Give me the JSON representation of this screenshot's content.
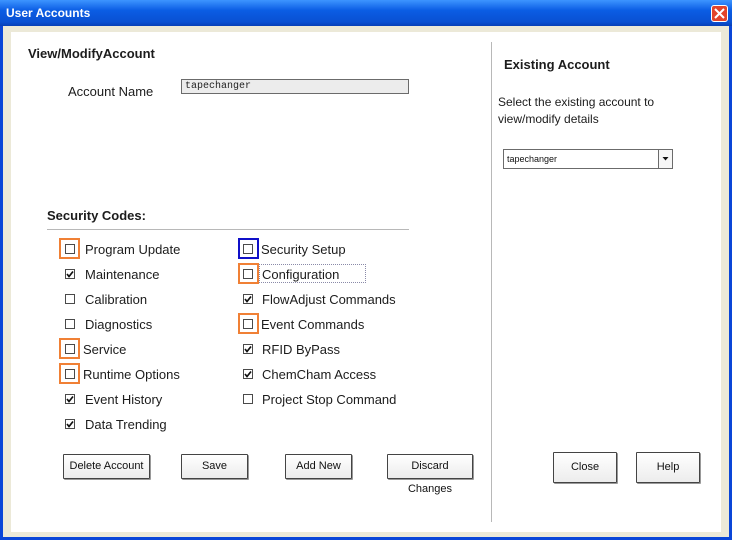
{
  "window": {
    "title": "User Accounts"
  },
  "view_modify": {
    "heading": "View/ModifyAccount",
    "account_name_label": "Account Name",
    "account_name_value": "tapechanger"
  },
  "security_codes": {
    "heading": "Security Codes:",
    "items": [
      {
        "label": "Program Update",
        "checked": false
      },
      {
        "label": "Maintenance",
        "checked": true
      },
      {
        "label": "Calibration",
        "checked": false
      },
      {
        "label": "Diagnostics",
        "checked": false
      },
      {
        "label": "Service",
        "checked": false
      },
      {
        "label": "Runtime Options",
        "checked": false
      },
      {
        "label": "Event History",
        "checked": true
      },
      {
        "label": "Data Trending",
        "checked": true
      },
      {
        "label": "Security Setup",
        "checked": false
      },
      {
        "label": "Configuration",
        "checked": false
      },
      {
        "label": "FlowAdjust Commands",
        "checked": true
      },
      {
        "label": "Event Commands",
        "checked": false
      },
      {
        "label": "RFID ByPass",
        "checked": true
      },
      {
        "label": "ChemCham Access",
        "checked": true
      },
      {
        "label": "Project Stop Command",
        "checked": false
      }
    ]
  },
  "buttons": {
    "delete": "Delete Account",
    "save": "Save",
    "add_new": "Add New",
    "discard": "Discard Changes",
    "close": "Close",
    "help": "Help"
  },
  "existing_account": {
    "heading": "Existing Account",
    "description_line1": "Select the existing account to",
    "description_line2": "view/modify details",
    "selected": "tapechanger"
  },
  "colors": {
    "title_bar": "#0b5de4",
    "highlight_orange": "#f08035",
    "highlight_blue": "#1010c8"
  }
}
